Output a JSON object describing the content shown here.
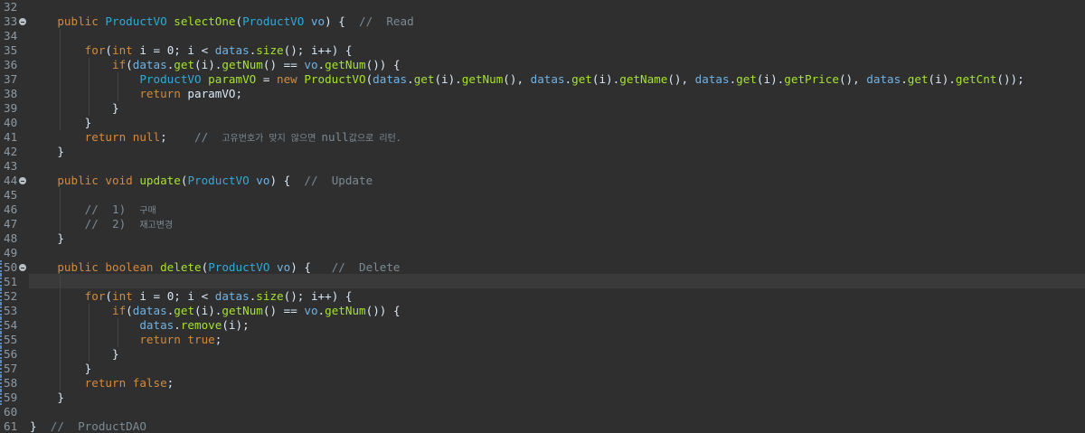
{
  "editor": {
    "active_line": 51,
    "lines": [
      {
        "no": "32",
        "fold": false,
        "tokens": []
      },
      {
        "no": "33",
        "fold": true,
        "tokens": [
          {
            "t": "    ",
            "c": "text"
          },
          {
            "t": "public ",
            "c": "kw"
          },
          {
            "t": "ProductVO ",
            "c": "type"
          },
          {
            "t": "selectOne",
            "c": "method"
          },
          {
            "t": "(",
            "c": "text"
          },
          {
            "t": "ProductVO ",
            "c": "type"
          },
          {
            "t": "vo",
            "c": "var"
          },
          {
            "t": ") {  ",
            "c": "text"
          },
          {
            "t": "//  Read",
            "c": "comment"
          }
        ]
      },
      {
        "no": "34",
        "fold": false,
        "tokens": []
      },
      {
        "no": "35",
        "fold": false,
        "tokens": [
          {
            "t": "        ",
            "c": "text"
          },
          {
            "t": "for",
            "c": "kw"
          },
          {
            "t": "(",
            "c": "text"
          },
          {
            "t": "int ",
            "c": "kw"
          },
          {
            "t": "i = 0; i < ",
            "c": "text"
          },
          {
            "t": "datas",
            "c": "var"
          },
          {
            "t": ".",
            "c": "text"
          },
          {
            "t": "size",
            "c": "method"
          },
          {
            "t": "(); i++) {",
            "c": "text"
          }
        ]
      },
      {
        "no": "36",
        "fold": false,
        "tokens": [
          {
            "t": "            ",
            "c": "text"
          },
          {
            "t": "if",
            "c": "kw"
          },
          {
            "t": "(",
            "c": "text"
          },
          {
            "t": "datas",
            "c": "var"
          },
          {
            "t": ".",
            "c": "text"
          },
          {
            "t": "get",
            "c": "method"
          },
          {
            "t": "(i).",
            "c": "text"
          },
          {
            "t": "getNum",
            "c": "method"
          },
          {
            "t": "() == ",
            "c": "text"
          },
          {
            "t": "vo",
            "c": "var"
          },
          {
            "t": ".",
            "c": "text"
          },
          {
            "t": "getNum",
            "c": "method"
          },
          {
            "t": "()) {",
            "c": "text"
          }
        ]
      },
      {
        "no": "37",
        "fold": false,
        "tokens": [
          {
            "t": "                ",
            "c": "text"
          },
          {
            "t": "ProductVO ",
            "c": "type"
          },
          {
            "t": "paramVO",
            "c": "method"
          },
          {
            "t": " = ",
            "c": "text"
          },
          {
            "t": "new ",
            "c": "kw"
          },
          {
            "t": "ProductVO",
            "c": "method"
          },
          {
            "t": "(",
            "c": "text"
          },
          {
            "t": "datas",
            "c": "var"
          },
          {
            "t": ".",
            "c": "text"
          },
          {
            "t": "get",
            "c": "method"
          },
          {
            "t": "(i).",
            "c": "text"
          },
          {
            "t": "getNum",
            "c": "method"
          },
          {
            "t": "(), ",
            "c": "text"
          },
          {
            "t": "datas",
            "c": "var"
          },
          {
            "t": ".",
            "c": "text"
          },
          {
            "t": "get",
            "c": "method"
          },
          {
            "t": "(i).",
            "c": "text"
          },
          {
            "t": "getName",
            "c": "method"
          },
          {
            "t": "(), ",
            "c": "text"
          },
          {
            "t": "datas",
            "c": "var"
          },
          {
            "t": ".",
            "c": "text"
          },
          {
            "t": "get",
            "c": "method"
          },
          {
            "t": "(i).",
            "c": "text"
          },
          {
            "t": "getPrice",
            "c": "method"
          },
          {
            "t": "(), ",
            "c": "text"
          },
          {
            "t": "datas",
            "c": "var"
          },
          {
            "t": ".",
            "c": "text"
          },
          {
            "t": "get",
            "c": "method"
          },
          {
            "t": "(i).",
            "c": "text"
          },
          {
            "t": "getCnt",
            "c": "method"
          },
          {
            "t": "());",
            "c": "text"
          }
        ]
      },
      {
        "no": "38",
        "fold": false,
        "tokens": [
          {
            "t": "                ",
            "c": "text"
          },
          {
            "t": "return ",
            "c": "kw"
          },
          {
            "t": "paramVO;",
            "c": "text"
          }
        ]
      },
      {
        "no": "39",
        "fold": false,
        "tokens": [
          {
            "t": "            }",
            "c": "text"
          }
        ]
      },
      {
        "no": "40",
        "fold": false,
        "tokens": [
          {
            "t": "        }",
            "c": "text"
          }
        ]
      },
      {
        "no": "41",
        "fold": false,
        "tokens": [
          {
            "t": "        ",
            "c": "text"
          },
          {
            "t": "return ",
            "c": "kw"
          },
          {
            "t": "null",
            "c": "kw"
          },
          {
            "t": ";    ",
            "c": "text"
          },
          {
            "t": "//  ",
            "c": "comment"
          },
          {
            "t": "고유번호가 맞지 않으면 ",
            "c": "small-comment"
          },
          {
            "t": "null",
            "c": "comment"
          },
          {
            "t": "값으로 리턴.",
            "c": "small-comment"
          }
        ]
      },
      {
        "no": "42",
        "fold": false,
        "tokens": [
          {
            "t": "    }",
            "c": "text"
          }
        ]
      },
      {
        "no": "43",
        "fold": false,
        "tokens": []
      },
      {
        "no": "44",
        "fold": true,
        "tokens": [
          {
            "t": "    ",
            "c": "text"
          },
          {
            "t": "public ",
            "c": "kw"
          },
          {
            "t": "void ",
            "c": "kw"
          },
          {
            "t": "update",
            "c": "method"
          },
          {
            "t": "(",
            "c": "text"
          },
          {
            "t": "ProductVO ",
            "c": "type"
          },
          {
            "t": "vo",
            "c": "var"
          },
          {
            "t": ") {  ",
            "c": "text"
          },
          {
            "t": "//  Update",
            "c": "comment"
          }
        ]
      },
      {
        "no": "45",
        "fold": false,
        "tokens": []
      },
      {
        "no": "46",
        "fold": false,
        "tokens": [
          {
            "t": "        ",
            "c": "text"
          },
          {
            "t": "//  1)  ",
            "c": "comment"
          },
          {
            "t": "구매",
            "c": "small-comment"
          }
        ]
      },
      {
        "no": "47",
        "fold": false,
        "tokens": [
          {
            "t": "        ",
            "c": "text"
          },
          {
            "t": "//  2)  ",
            "c": "comment"
          },
          {
            "t": "재고변경",
            "c": "small-comment"
          }
        ]
      },
      {
        "no": "48",
        "fold": false,
        "tokens": [
          {
            "t": "    }",
            "c": "text"
          }
        ]
      },
      {
        "no": "49",
        "fold": false,
        "tokens": []
      },
      {
        "no": "50",
        "fold": true,
        "tokens": [
          {
            "t": "    ",
            "c": "text"
          },
          {
            "t": "public ",
            "c": "kw"
          },
          {
            "t": "boolean ",
            "c": "kw"
          },
          {
            "t": "delete",
            "c": "method"
          },
          {
            "t": "(",
            "c": "text"
          },
          {
            "t": "ProductVO ",
            "c": "type"
          },
          {
            "t": "vo",
            "c": "var"
          },
          {
            "t": ") {   ",
            "c": "text"
          },
          {
            "t": "//  Delete",
            "c": "comment"
          }
        ]
      },
      {
        "no": "51",
        "fold": false,
        "tokens": []
      },
      {
        "no": "52",
        "fold": false,
        "tokens": [
          {
            "t": "        ",
            "c": "text"
          },
          {
            "t": "for",
            "c": "kw"
          },
          {
            "t": "(",
            "c": "text"
          },
          {
            "t": "int ",
            "c": "kw"
          },
          {
            "t": "i = 0; i < ",
            "c": "text"
          },
          {
            "t": "datas",
            "c": "var"
          },
          {
            "t": ".",
            "c": "text"
          },
          {
            "t": "size",
            "c": "method"
          },
          {
            "t": "(); i++) {",
            "c": "text"
          }
        ]
      },
      {
        "no": "53",
        "fold": false,
        "tokens": [
          {
            "t": "            ",
            "c": "text"
          },
          {
            "t": "if",
            "c": "kw"
          },
          {
            "t": "(",
            "c": "text"
          },
          {
            "t": "datas",
            "c": "var"
          },
          {
            "t": ".",
            "c": "text"
          },
          {
            "t": "get",
            "c": "method"
          },
          {
            "t": "(i).",
            "c": "text"
          },
          {
            "t": "getNum",
            "c": "method"
          },
          {
            "t": "() == ",
            "c": "text"
          },
          {
            "t": "vo",
            "c": "var"
          },
          {
            "t": ".",
            "c": "text"
          },
          {
            "t": "getNum",
            "c": "method"
          },
          {
            "t": "()) {",
            "c": "text"
          }
        ]
      },
      {
        "no": "54",
        "fold": false,
        "tokens": [
          {
            "t": "                ",
            "c": "text"
          },
          {
            "t": "datas",
            "c": "var"
          },
          {
            "t": ".",
            "c": "text"
          },
          {
            "t": "remove",
            "c": "method"
          },
          {
            "t": "(i);",
            "c": "text"
          }
        ]
      },
      {
        "no": "55",
        "fold": false,
        "tokens": [
          {
            "t": "                ",
            "c": "text"
          },
          {
            "t": "return ",
            "c": "kw"
          },
          {
            "t": "true",
            "c": "kw"
          },
          {
            "t": ";",
            "c": "text"
          }
        ]
      },
      {
        "no": "56",
        "fold": false,
        "tokens": [
          {
            "t": "            }",
            "c": "text"
          }
        ]
      },
      {
        "no": "57",
        "fold": false,
        "tokens": [
          {
            "t": "        }",
            "c": "text"
          }
        ]
      },
      {
        "no": "58",
        "fold": false,
        "tokens": [
          {
            "t": "        ",
            "c": "text"
          },
          {
            "t": "return ",
            "c": "kw"
          },
          {
            "t": "false",
            "c": "kw"
          },
          {
            "t": ";",
            "c": "text"
          }
        ]
      },
      {
        "no": "59",
        "fold": false,
        "tokens": [
          {
            "t": "    }",
            "c": "text"
          }
        ]
      },
      {
        "no": "60",
        "fold": false,
        "tokens": []
      },
      {
        "no": "61",
        "fold": false,
        "tokens": [
          {
            "t": "}  ",
            "c": "text"
          },
          {
            "t": "//  ProductDAO",
            "c": "comment"
          }
        ]
      }
    ]
  }
}
